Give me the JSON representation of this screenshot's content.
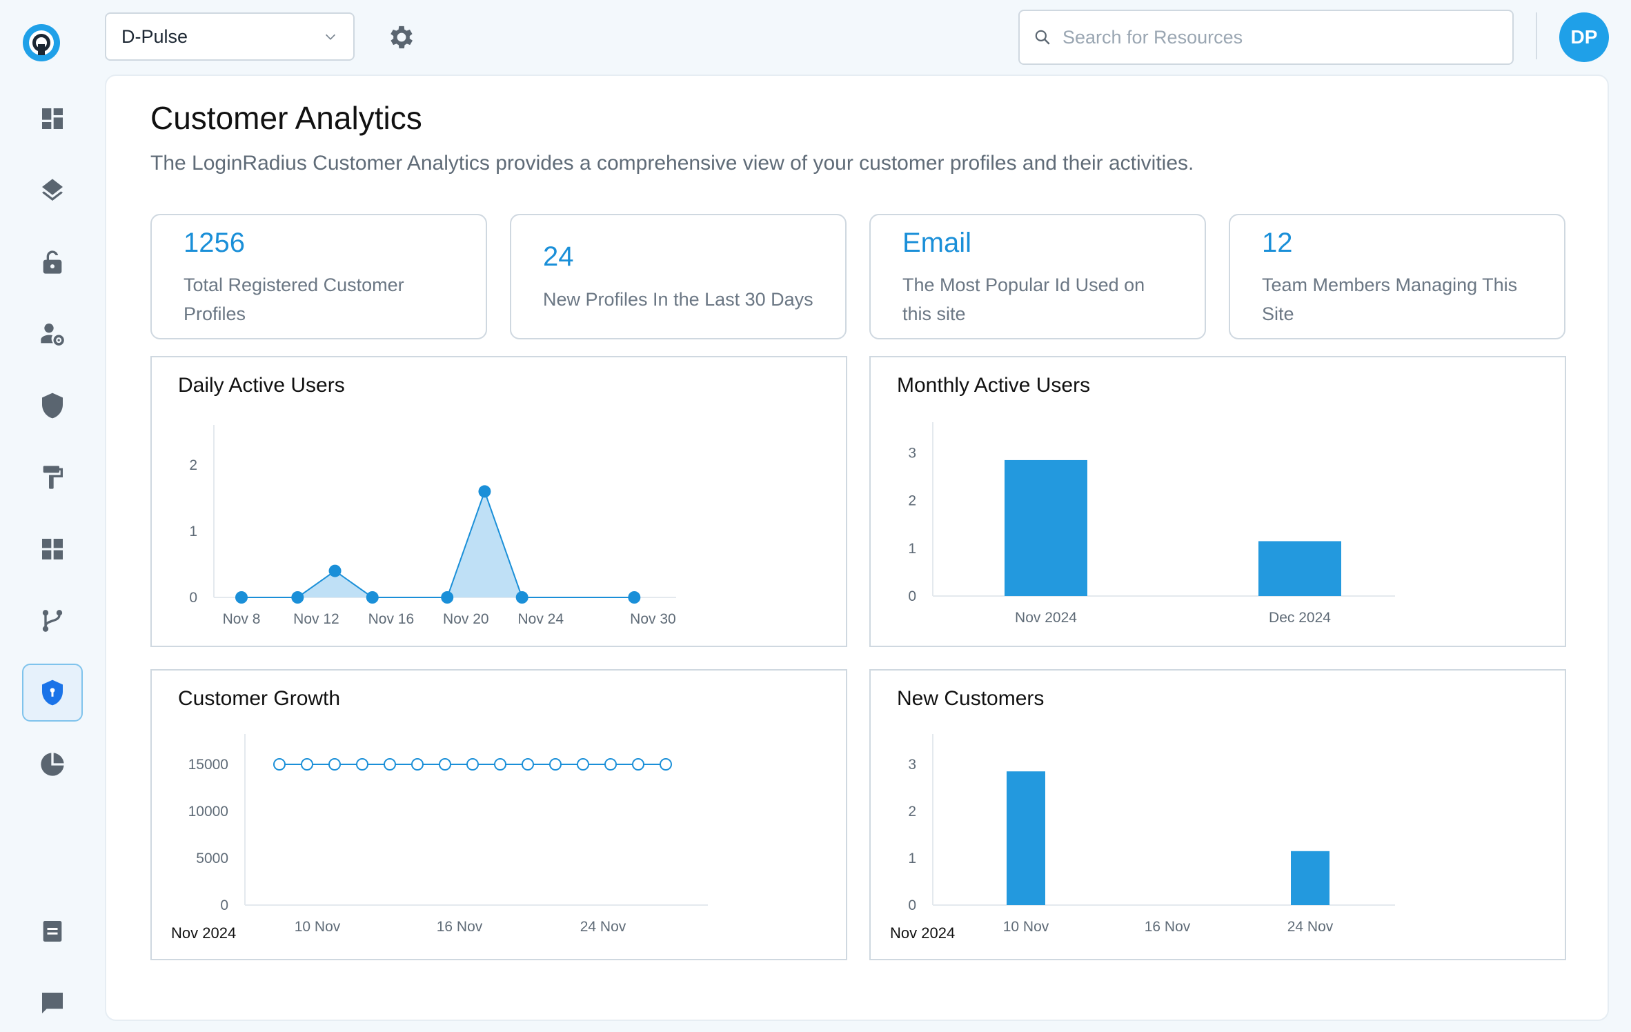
{
  "app_select": {
    "value": "D-Pulse"
  },
  "search": {
    "placeholder": "Search for Resources"
  },
  "avatar": {
    "initials": "DP"
  },
  "sidebar": {
    "items": [
      {
        "name": "dashboard"
      },
      {
        "name": "layers"
      },
      {
        "name": "unlock"
      },
      {
        "name": "user-settings"
      },
      {
        "name": "shield"
      },
      {
        "name": "paint-roller"
      },
      {
        "name": "apps-grid"
      },
      {
        "name": "flow-branch"
      },
      {
        "name": "shield-lock",
        "active": true
      },
      {
        "name": "pie-chart"
      },
      {
        "name": "document"
      },
      {
        "name": "chat"
      }
    ]
  },
  "page": {
    "title": "Customer Analytics",
    "description": "The LoginRadius Customer Analytics provides a comprehensive view of your customer profiles and their activities."
  },
  "stats": [
    {
      "value": "1256",
      "label": "Total Registered Customer Profiles"
    },
    {
      "value": "24",
      "label": "New Profiles In the Last 30 Days"
    },
    {
      "value": "Email",
      "label": "The Most Popular Id Used on this site"
    },
    {
      "value": "12",
      "label": "Team Members Managing This Site"
    }
  ],
  "colors": {
    "accent": "#1a8fd8",
    "bar": "#2399de",
    "area_fill": "#bfe0f6",
    "line": "#1a8fd8"
  },
  "chart_data": [
    {
      "id": "daily",
      "type": "area",
      "title": "Daily Active Users",
      "x": [
        "Nov 8",
        "Nov 11",
        "Nov 13",
        "Nov 15",
        "Nov 19",
        "Nov 21",
        "Nov 23",
        "Nov 29"
      ],
      "values": [
        0,
        0,
        0.4,
        0,
        0,
        1.6,
        0,
        0
      ],
      "x_ticks": [
        "Nov 8",
        "Nov 12",
        "Nov 16",
        "Nov 20",
        "Nov 24",
        "Nov 30"
      ],
      "y_ticks": [
        0,
        1,
        2
      ],
      "ylim": [
        0,
        2.5
      ]
    },
    {
      "id": "monthly",
      "type": "bar",
      "title": "Monthly Active Users",
      "categories": [
        "Nov 2024",
        "Dec 2024"
      ],
      "values": [
        2.85,
        1.15
      ],
      "y_ticks": [
        0,
        1,
        2,
        3
      ],
      "ylim": [
        0,
        3.5
      ]
    },
    {
      "id": "growth",
      "type": "line",
      "title": "Customer Growth",
      "x": [
        "Nov 4",
        "Nov 5",
        "Nov 6",
        "Nov 7",
        "Nov 8",
        "Nov 9",
        "Nov 10",
        "Nov 11",
        "Nov 12",
        "Nov 13",
        "Nov 14",
        "Nov 15",
        "Nov 16",
        "Nov 17",
        "Nov 18"
      ],
      "values": [
        15000,
        15000,
        15000,
        15000,
        15000,
        15000,
        15000,
        15000,
        15000,
        15000,
        15000,
        15000,
        15000,
        15000,
        15000
      ],
      "x_ticks": [
        "10 Nov",
        "16 Nov",
        "24 Nov"
      ],
      "period_label": "Nov 2024",
      "y_ticks": [
        0,
        5000,
        10000,
        15000
      ],
      "ylim": [
        0,
        17500
      ]
    },
    {
      "id": "newcust",
      "type": "bar",
      "title": "New Customers",
      "categories": [
        "10 Nov",
        "24 Nov"
      ],
      "values": [
        2.85,
        1.15
      ],
      "x_ticks": [
        "10 Nov",
        "16 Nov",
        "24 Nov"
      ],
      "period_label": "Nov 2024",
      "y_ticks": [
        0,
        1,
        2,
        3
      ],
      "ylim": [
        0,
        3.5
      ]
    }
  ]
}
